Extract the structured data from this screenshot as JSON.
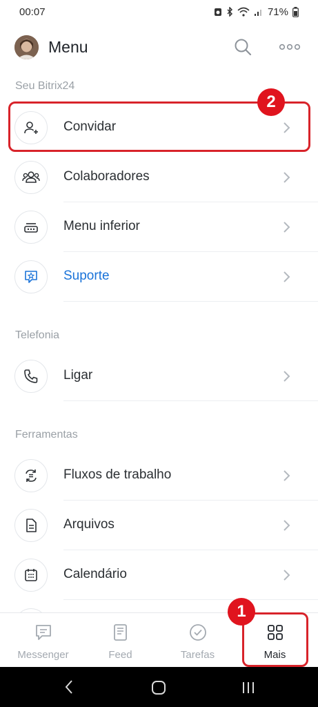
{
  "status_bar": {
    "time": "00:07",
    "battery": "71%"
  },
  "header": {
    "title": "Menu",
    "avatar_icon": "user-avatar",
    "search_icon": "search-icon",
    "more_icon": "more-dots-icon"
  },
  "sections": [
    {
      "title": "Seu Bitrix24",
      "items": [
        {
          "label": "Convidar",
          "icon": "add-user-icon",
          "color": "#2b2f33"
        },
        {
          "label": "Colaboradores",
          "icon": "group-icon",
          "color": "#2b2f33"
        },
        {
          "label": "Menu inferior",
          "icon": "menu-bar-icon",
          "color": "#2b2f33"
        },
        {
          "label": "Suporte",
          "icon": "support-chat-icon",
          "color": "#1a73d9"
        }
      ]
    },
    {
      "title": "Telefonia",
      "items": [
        {
          "label": "Ligar",
          "icon": "phone-icon",
          "color": "#2b2f33"
        }
      ]
    },
    {
      "title": "Ferramentas",
      "items": [
        {
          "label": "Fluxos de trabalho",
          "icon": "workflow-icon",
          "color": "#2b2f33"
        },
        {
          "label": "Arquivos",
          "icon": "file-icon",
          "color": "#2b2f33"
        },
        {
          "label": "Calendário",
          "icon": "calendar-icon",
          "color": "#2b2f33"
        }
      ]
    }
  ],
  "bottom_nav": [
    {
      "label": "Messenger",
      "icon": "chat-icon",
      "active": false
    },
    {
      "label": "Feed",
      "icon": "feed-icon",
      "active": false
    },
    {
      "label": "Tarefas",
      "icon": "check-circle-icon",
      "active": false
    },
    {
      "label": "Mais",
      "icon": "grid-icon",
      "active": true
    }
  ],
  "annotations": {
    "badge_1": "1",
    "badge_2": "2",
    "highlight_color": "#d8232a"
  }
}
